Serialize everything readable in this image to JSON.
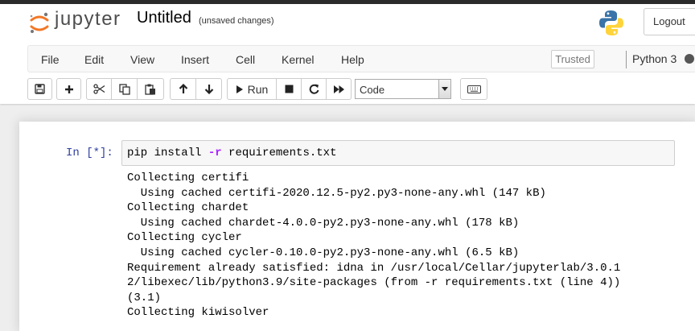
{
  "header": {
    "logo_text": "jupyter",
    "notebook_title": "Untitled",
    "save_status": "(unsaved changes)",
    "logout_label": "Logout"
  },
  "menu": {
    "items": [
      {
        "label": "File"
      },
      {
        "label": "Edit"
      },
      {
        "label": "View"
      },
      {
        "label": "Insert"
      },
      {
        "label": "Cell"
      },
      {
        "label": "Kernel"
      },
      {
        "label": "Help"
      }
    ],
    "trusted_label": "Trusted",
    "kernel_name": "Python 3"
  },
  "toolbar": {
    "run_label": "Run",
    "cell_type": "Code"
  },
  "cell": {
    "prompt": "In [*]:",
    "code_pre": "pip install ",
    "code_flag": "-r",
    "code_post": " requirements.txt"
  },
  "output_lines": [
    "Collecting certifi",
    "  Using cached certifi-2020.12.5-py2.py3-none-any.whl (147 kB)",
    "Collecting chardet",
    "  Using cached chardet-4.0.0-py2.py3-none-any.whl (178 kB)",
    "Collecting cycler",
    "  Using cached cycler-0.10.0-py2.py3-none-any.whl (6.5 kB)",
    "Requirement already satisfied: idna in /usr/local/Cellar/jupyterlab/3.0.1",
    "2/libexec/lib/python3.9/site-packages (from -r requirements.txt (line 4))",
    "(3.1)",
    "Collecting kiwisolver"
  ],
  "colors": {
    "prompt": "#303f9f",
    "logo_orange": "#f37726",
    "python_blue": "#3a74a8",
    "python_yellow": "#ffd43b"
  }
}
